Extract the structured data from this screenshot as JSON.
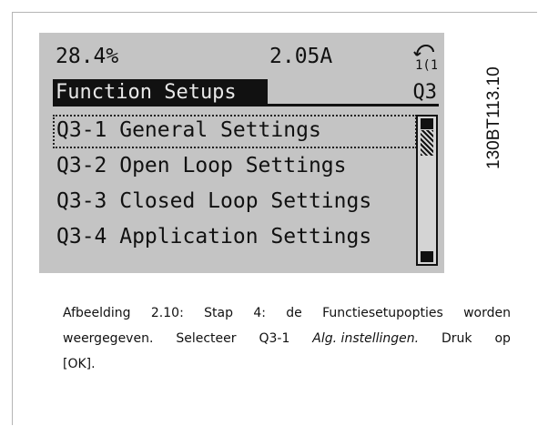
{
  "display": {
    "status_left": "28.4%",
    "status_mid": "2.05A",
    "status_icon": "hand-local-icon",
    "title": "Function Setups",
    "title_code": "Q3",
    "menu_items": [
      {
        "label": "Q3-1 General Settings",
        "selected": true
      },
      {
        "label": "Q3-2 Open Loop Settings",
        "selected": false
      },
      {
        "label": "Q3-3 Closed Loop Settings",
        "selected": false
      },
      {
        "label": "Q3-4 Application Settings",
        "selected": false
      }
    ]
  },
  "side_code": "130BT113.10",
  "caption": {
    "line1": [
      "Afbeelding",
      "2.10:",
      "Stap",
      "4:",
      "de",
      "Functiesetupopties",
      "worden"
    ],
    "line2_pre": [
      "weergegeven.",
      "Selecteer",
      "Q3-1"
    ],
    "line2_em": "Alg. instellingen.",
    "line2_post": [
      "Druk",
      "op"
    ],
    "line3": "[OK]."
  }
}
